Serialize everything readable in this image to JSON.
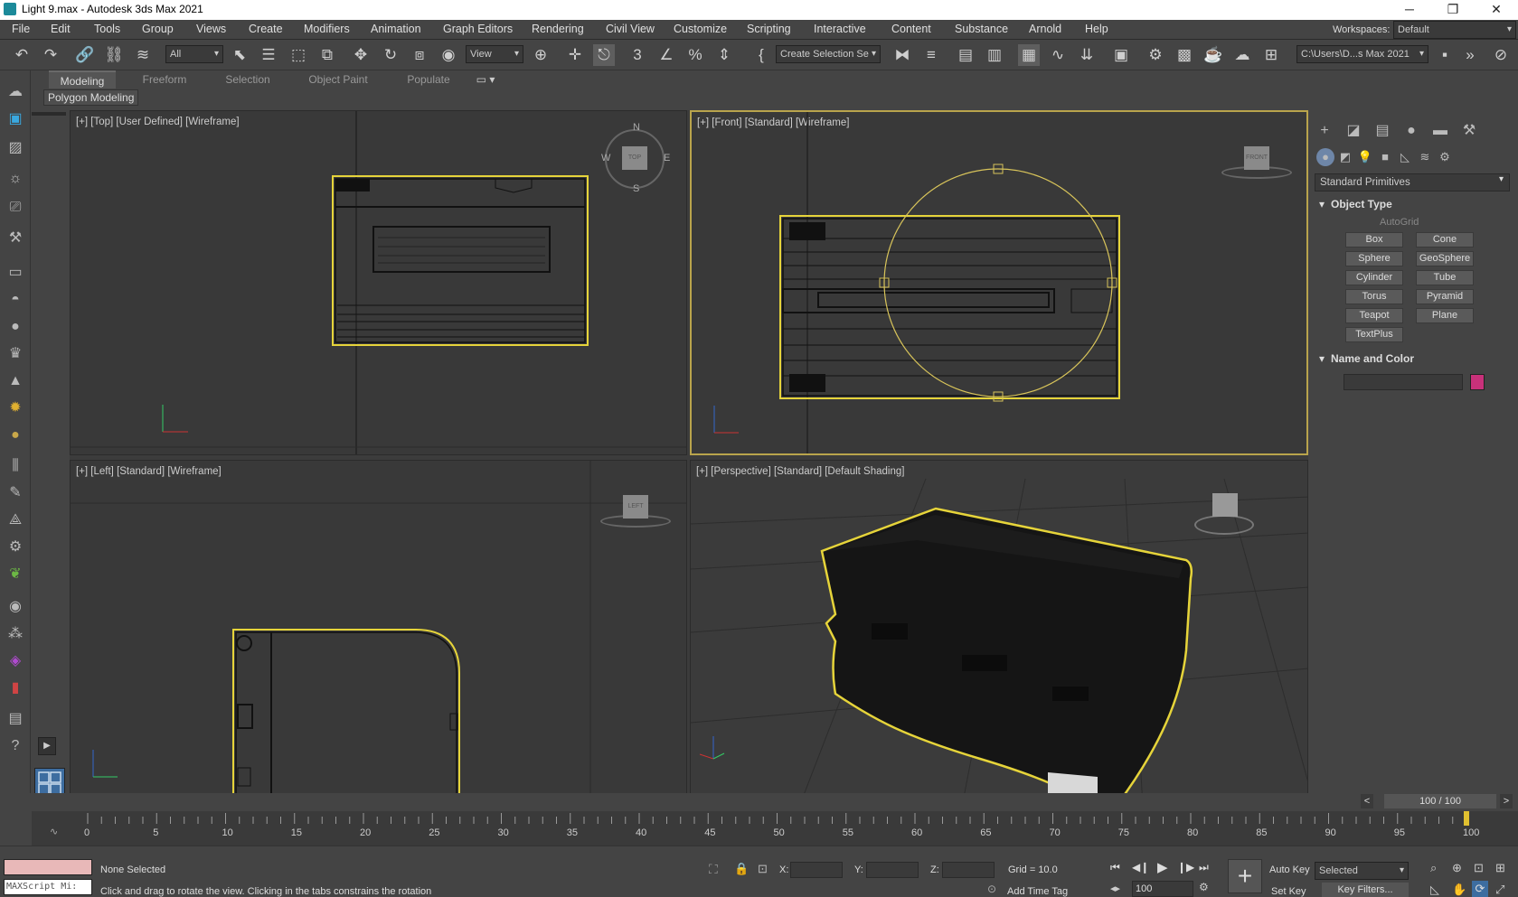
{
  "window": {
    "title": "Light 9.max - Autodesk 3ds Max 2021"
  },
  "menu": [
    "File",
    "Edit",
    "Tools",
    "Group",
    "Views",
    "Create",
    "Modifiers",
    "Animation",
    "Graph Editors",
    "Rendering",
    "Civil View",
    "Customize",
    "Scripting",
    "Interactive",
    "Content",
    "Substance",
    "Arnold",
    "Help"
  ],
  "workspaces": {
    "label": "Workspaces:",
    "value": "Default"
  },
  "toolbar": {
    "filter": "All",
    "refcoord": "View",
    "selset": "Create Selection Se",
    "path": "C:\\Users\\D...s Max 2021"
  },
  "ribbon": {
    "tabs": [
      "Modeling",
      "Freeform",
      "Selection",
      "Object Paint",
      "Populate"
    ],
    "panel": "Polygon Modeling"
  },
  "viewports": {
    "top": "[+] [Top] [User Defined] [Wireframe]",
    "front": "[+] [Front] [Standard] [Wireframe]",
    "left": "[+] [Left] [Standard] [Wireframe]",
    "persp": "[+] [Perspective] [Standard] [Default Shading]"
  },
  "navcube": {
    "top": "TOP",
    "front": "FRONT",
    "left": "LEFT",
    "n": "N",
    "s": "S",
    "e": "E",
    "w": "W"
  },
  "command": {
    "category": "Standard Primitives",
    "object_type": "Object Type",
    "autogrid": "AutoGrid",
    "buttons": [
      "Box",
      "Cone",
      "Sphere",
      "GeoSphere",
      "Cylinder",
      "Tube",
      "Torus",
      "Pyramid",
      "Teapot",
      "Plane",
      "TextPlus"
    ],
    "name_color": "Name and Color",
    "object_color": "#c8317a"
  },
  "timeslider": {
    "label": "100 / 100",
    "prev": "<",
    "next": ">",
    "ticks": [
      "0",
      "5",
      "10",
      "15",
      "20",
      "25",
      "30",
      "35",
      "40",
      "45",
      "50",
      "55",
      "60",
      "65",
      "70",
      "75",
      "80",
      "85",
      "90",
      "95",
      "100"
    ]
  },
  "status": {
    "maxscript": "MAXScript Mi:",
    "selection": "None Selected",
    "prompt": "Click and drag to rotate the view.  Clicking in the tabs constrains the rotation",
    "x_label": "X:",
    "y_label": "Y:",
    "z_label": "Z:",
    "grid": "Grid = 10.0",
    "add_time_tag": "Add Time Tag",
    "autokey": "Auto Key",
    "selected": "Selected",
    "setkey": "Set Key",
    "keyfilters": "Key Filters...",
    "frame": "100"
  }
}
